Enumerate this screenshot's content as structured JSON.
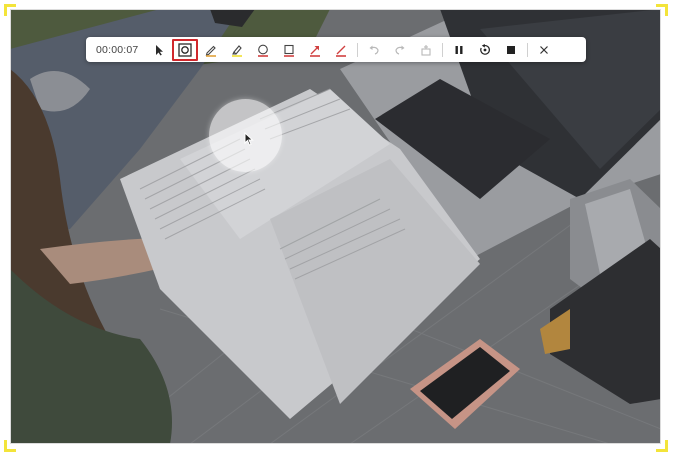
{
  "toolbar": {
    "timer": "00:00:07",
    "tools": [
      {
        "id": "select",
        "icon": "pointer-arrow-icon"
      },
      {
        "id": "spotlight",
        "icon": "spotlight-frame-icon",
        "active": true
      },
      {
        "id": "pen",
        "icon": "pen-icon"
      },
      {
        "id": "highlighter",
        "icon": "highlighter-icon"
      },
      {
        "id": "ellipse",
        "icon": "ellipse-icon"
      },
      {
        "id": "rectangle",
        "icon": "rectangle-icon"
      },
      {
        "id": "arrow",
        "icon": "arrow-icon"
      },
      {
        "id": "line",
        "icon": "line-icon"
      },
      {
        "id": "undo",
        "icon": "undo-icon"
      },
      {
        "id": "redo",
        "icon": "redo-icon"
      },
      {
        "id": "clear",
        "icon": "eraser-icon"
      },
      {
        "id": "pause",
        "icon": "pause-icon"
      },
      {
        "id": "restart",
        "icon": "restart-icon"
      },
      {
        "id": "stop",
        "icon": "stop-icon"
      },
      {
        "id": "close",
        "icon": "close-icon"
      }
    ]
  },
  "colors": {
    "active_outline": "#d0282d",
    "handle": "#f3e43a",
    "pen_stroke": "#e0a13a",
    "highlighter_stroke": "#f0e030",
    "ellipse_stroke": "#d04040",
    "rectangle_stroke": "#d04040",
    "arrow_stroke": "#d04040",
    "line_stroke": "#d04040"
  }
}
